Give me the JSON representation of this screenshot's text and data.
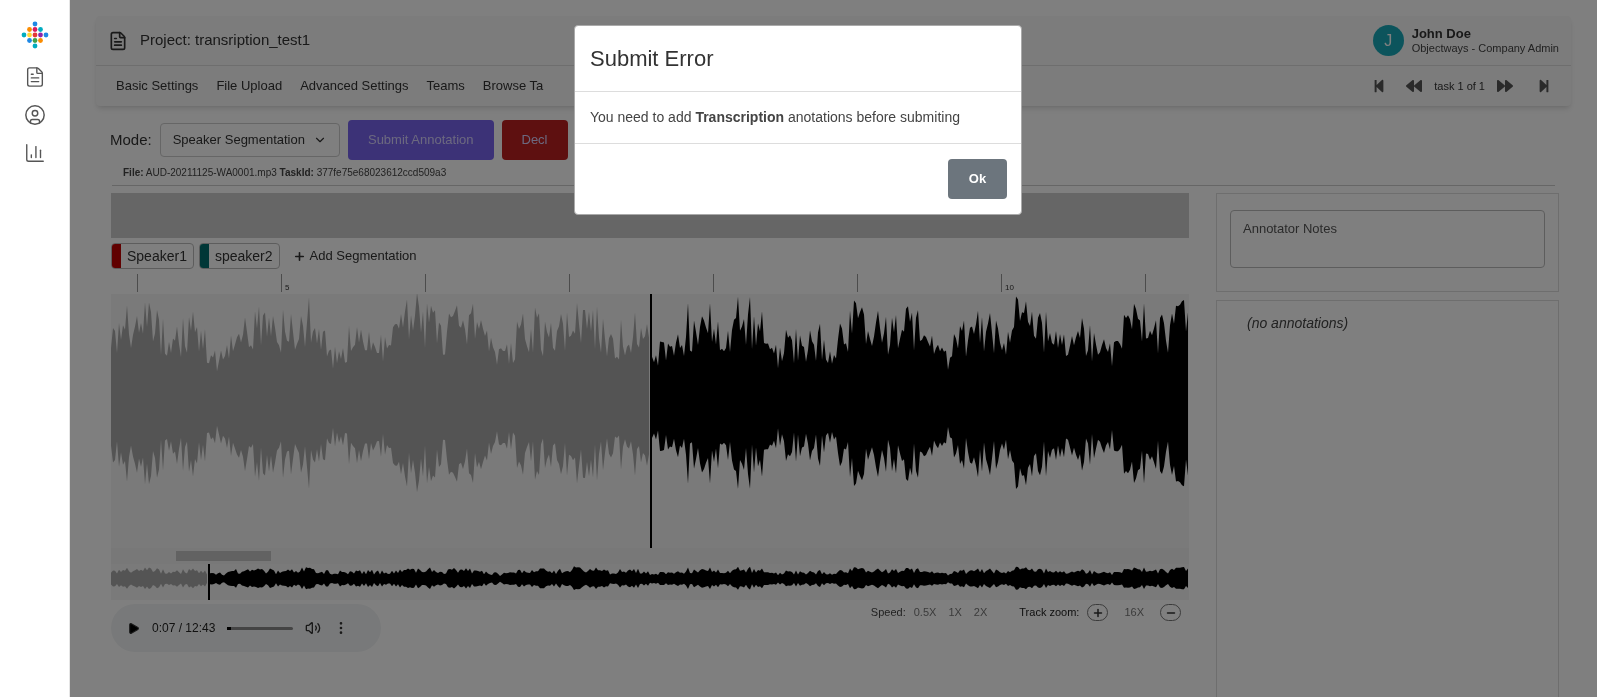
{
  "project": {
    "title": "Project: transription_test1"
  },
  "user": {
    "initial": "J",
    "name": "John Doe",
    "role": "Objectways - Company Admin"
  },
  "tabs": [
    "Basic Settings",
    "File Upload",
    "Advanced Settings",
    "Teams",
    "Browse Ta"
  ],
  "pager": {
    "label": "task 1 of 1"
  },
  "mode": {
    "label": "Mode:",
    "value": "Speaker Segmentation"
  },
  "actions": [
    {
      "label": "Submit Annotation",
      "kind": "primary"
    },
    {
      "label": "Decl",
      "kind": "danger"
    }
  ],
  "file_info": "**File:** AUD-20211125-WA0001.mp3 **TaskId:** 377fe75e68023612ccd509a3",
  "segments": [
    {
      "label": "Speaker1",
      "color": "#600000"
    },
    {
      "label": "speaker2",
      "color": "#003737"
    }
  ],
  "add_segmentation": "Add Segmentation",
  "ruler_labels": [
    "5",
    "10"
  ],
  "waveform": {
    "level": 0.5
  },
  "minimap": {
    "level": 0.09
  },
  "player": {
    "time": "0:07 / 12:43",
    "level": 0.05
  },
  "speed": {
    "label": "Speed:",
    "options": [
      "0.5X",
      "1X",
      "2X"
    ]
  },
  "zoom": {
    "label": "Track zoom:",
    "value": "16X"
  },
  "notes": {
    "placeholder": "Annotator Notes"
  },
  "annotations_empty": "(no annotations)",
  "dialog": {
    "title": "Submit Error",
    "message": "You need to add **Transcription** anotations before submiting",
    "button": "Ok"
  }
}
